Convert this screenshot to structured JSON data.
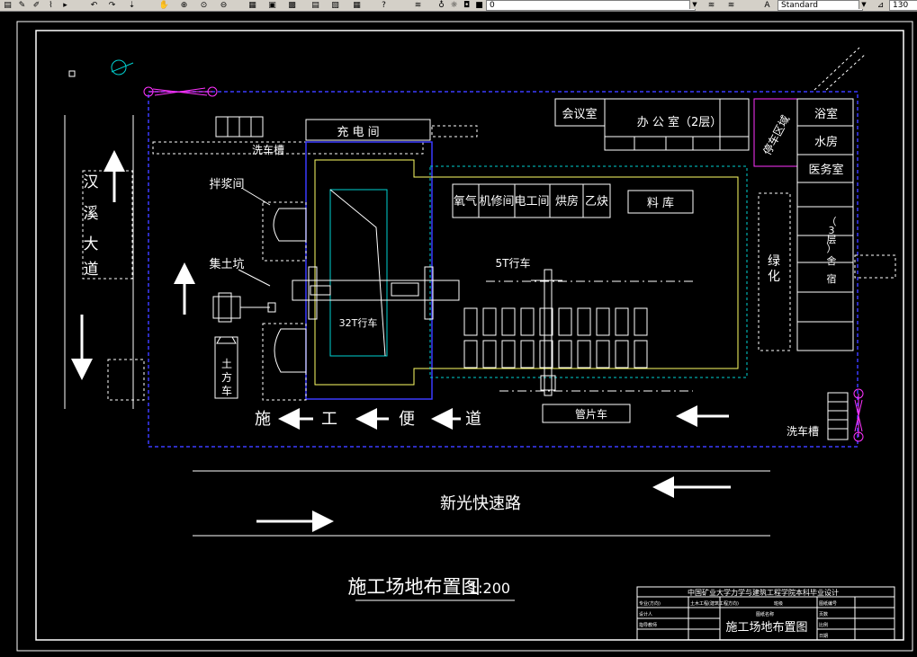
{
  "toolbar": {
    "icons": [
      "open-icon",
      "edit-icon",
      "paint-icon",
      "arrow-icon",
      "undo-icon",
      "redo-icon",
      "pan-icon",
      "zoom-realtime-icon",
      "zoom-window-icon",
      "zoom-previous-icon",
      "properties-icon",
      "design-center-icon",
      "tool-palette-icon",
      "sheet-icon",
      "calc-icon",
      "help-icon",
      "layer-icon",
      "light-icon",
      "sun-icon",
      "lock-icon",
      "color-icon"
    ],
    "layer_value": "0",
    "style_value": "Standard",
    "scale_value": "130"
  },
  "drawing": {
    "title": "施工场地布置图",
    "scale": "1:200",
    "road_main": "新光快速路",
    "road_left": [
      "汉",
      "溪",
      "大",
      "道"
    ],
    "site_road": [
      "施",
      "工",
      "便",
      "道"
    ],
    "labels": {
      "charging_room": "充 电 间",
      "wash_tank_top": "洗车槽",
      "wash_tank_right": "洗车槽",
      "mixing_room": "拌浆间",
      "soil_pit": "集土坑",
      "crane_32t": "32T行车",
      "crane_5t": "5T行车",
      "earth_truck": [
        "土",
        "方",
        "车"
      ],
      "pipe_truck": "管片车",
      "meeting_room": "会议室",
      "office": "办 公 室（2层）",
      "parking": "停车区域",
      "bath_room": "浴室",
      "water_room": "水房",
      "clinic": "医务室",
      "dorm": [
        "宿",
        "舍",
        "（",
        "3",
        "层",
        "）"
      ],
      "greening": [
        "绿",
        "化"
      ],
      "warehouse": "料  库",
      "workshops": [
        "氧气",
        "机修间",
        "电工间",
        "烘房",
        "乙炔"
      ]
    },
    "title_block": {
      "header": "中国矿业大学力学与建筑工程学院本科毕业设计",
      "drawing_name": "施工场地布置图",
      "cells": [
        "专业(方向)",
        "土木工程(建筑工程方向)",
        "班级",
        "图纸编号",
        "设计人",
        "图纸名称",
        "比例",
        "指导教师",
        "页数",
        "日期"
      ]
    }
  },
  "colors": {
    "background": "#000000",
    "line_white": "#ffffff",
    "boundary_blue": "#3a3aff",
    "dash_cyan": "#00d2d2",
    "magenta": "#ff33ff",
    "yellow": "#ffff66",
    "toolbar": "#d4d0c8"
  }
}
